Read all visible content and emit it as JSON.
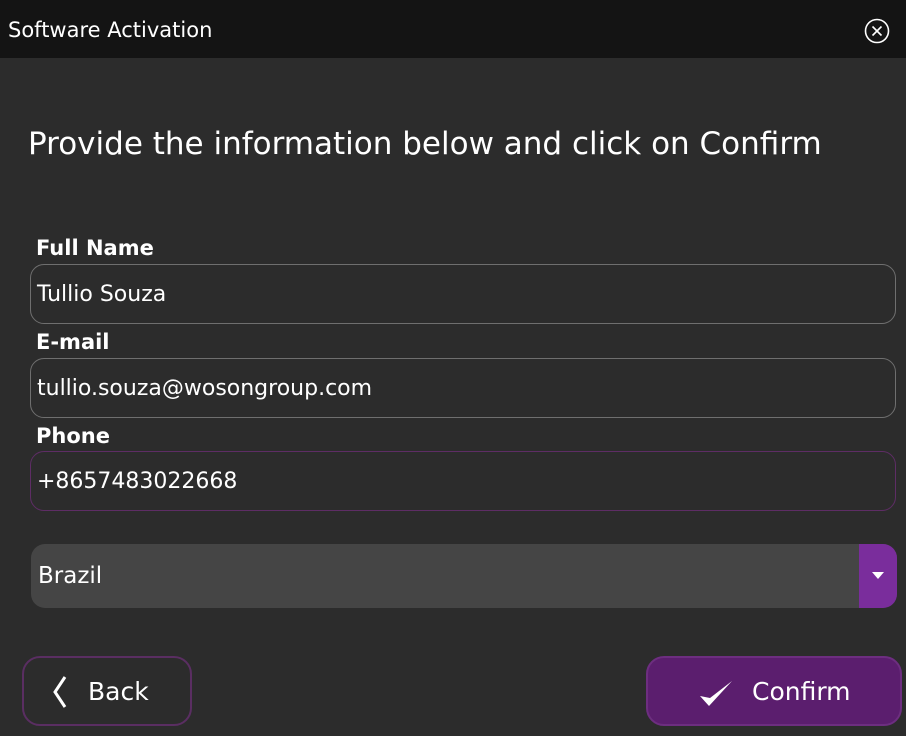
{
  "window": {
    "title": "Software Activation",
    "close_icon": "close-circle-icon"
  },
  "instruction": "Provide the information below and click on Confirm",
  "form": {
    "full_name": {
      "label": "Full Name",
      "value": "Tullio Souza"
    },
    "email": {
      "label": "E-mail",
      "value": "tullio.souza@wosongroup.com"
    },
    "phone": {
      "label": "Phone",
      "value": "+8657483022668"
    },
    "country": {
      "value": "Brazil",
      "icon": "chevron-down-icon"
    }
  },
  "buttons": {
    "back": {
      "label": "Back",
      "icon": "chevron-left-icon"
    },
    "confirm": {
      "label": "Confirm",
      "icon": "checkmark-icon"
    }
  },
  "colors": {
    "background": "#2c2c2c",
    "titlebar": "#141414",
    "accent": "#7a2d9c",
    "confirm_bg": "#5b1e6e",
    "field_border": "#6f6f6f",
    "purple_border": "#5e2d65"
  }
}
